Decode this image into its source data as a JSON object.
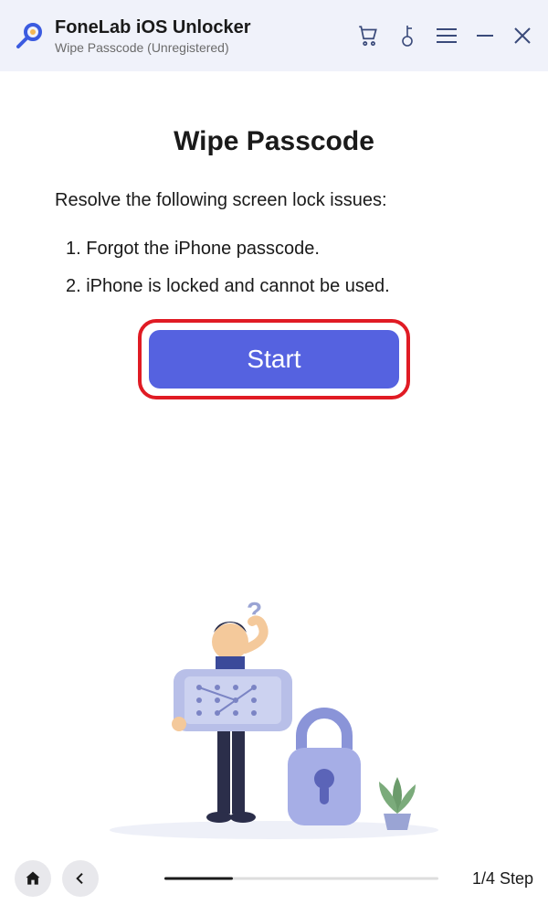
{
  "header": {
    "app_title": "FoneLab iOS Unlocker",
    "subtitle": "Wipe Passcode  (Unregistered)"
  },
  "main": {
    "page_title": "Wipe Passcode",
    "intro": "Resolve the following screen lock issues:",
    "issues": [
      "1. Forgot the iPhone passcode.",
      "2. iPhone is locked and cannot be used."
    ],
    "start_label": "Start"
  },
  "footer": {
    "step_text": "1/4 Step",
    "progress_percent": 25
  },
  "colors": {
    "accent": "#5562e0",
    "highlight_border": "#e01b24"
  }
}
